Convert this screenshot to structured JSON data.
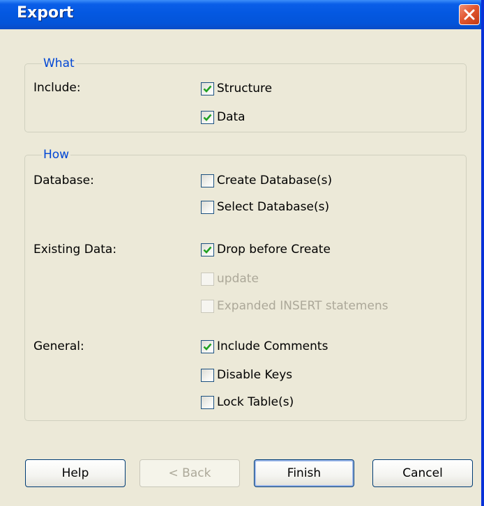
{
  "window": {
    "title": "Export"
  },
  "what_group": {
    "legend": "What",
    "include_label": "Include:",
    "options": [
      {
        "label": "Structure",
        "checked": true
      },
      {
        "label": "Data",
        "checked": true
      }
    ]
  },
  "how_group": {
    "legend": "How",
    "database_label": "Database:",
    "database_options": [
      {
        "label": "Create Database(s)",
        "checked": false
      },
      {
        "label": "Select Database(s)",
        "checked": false
      }
    ],
    "existing_label": "Existing Data:",
    "existing_options": [
      {
        "label": "Drop before Create",
        "checked": true,
        "enabled": true
      },
      {
        "label": "update",
        "checked": false,
        "enabled": false
      },
      {
        "label": "Expanded INSERT statemens",
        "checked": false,
        "enabled": false
      }
    ],
    "general_label": "General:",
    "general_options": [
      {
        "label": "Include Comments",
        "checked": true
      },
      {
        "label": "Disable Keys",
        "checked": false
      },
      {
        "label": "Lock Table(s)",
        "checked": false
      }
    ]
  },
  "buttons": {
    "help": "Help",
    "back": "< Back",
    "finish": "Finish",
    "cancel": "Cancel"
  },
  "colors": {
    "titlebar": "#0458e1",
    "group_legend": "#0046d5",
    "checkmark": "#21a121",
    "dialog_bg": "#ece9d8"
  }
}
